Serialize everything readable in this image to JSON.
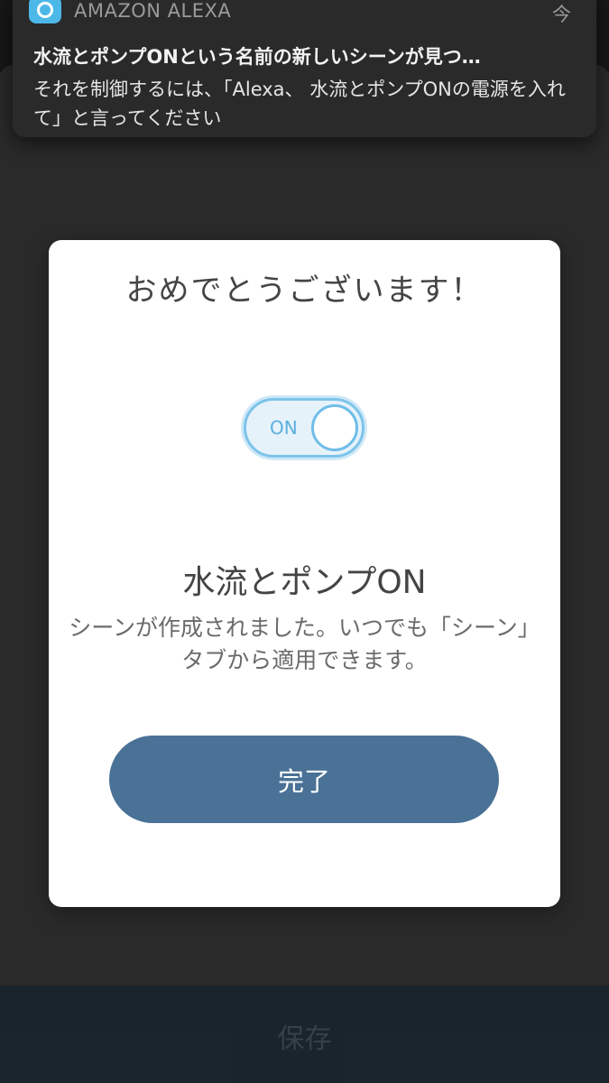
{
  "notification": {
    "app_name": "AMAZON ALEXA",
    "time": "今",
    "title": "水流とポンプONという名前の新しいシーンが見つ…",
    "body": "それを制御するには、「Alexa、 水流とポンプONの電源を入れて」と言ってください",
    "icon": "alexa-icon"
  },
  "dialog": {
    "title": "おめでとうございます！",
    "toggle": {
      "label": "ON",
      "state": "on"
    },
    "scene_name": "水流とポンプON",
    "description": "シーンが作成されました。いつでも「シーン」タブから適用できます。",
    "done_label": "完了"
  },
  "footer": {
    "save_label": "保存"
  },
  "colors": {
    "accent": "#4a7196",
    "toggle": "#7cc4ea",
    "alexa_icon": "#4cb8e8"
  }
}
